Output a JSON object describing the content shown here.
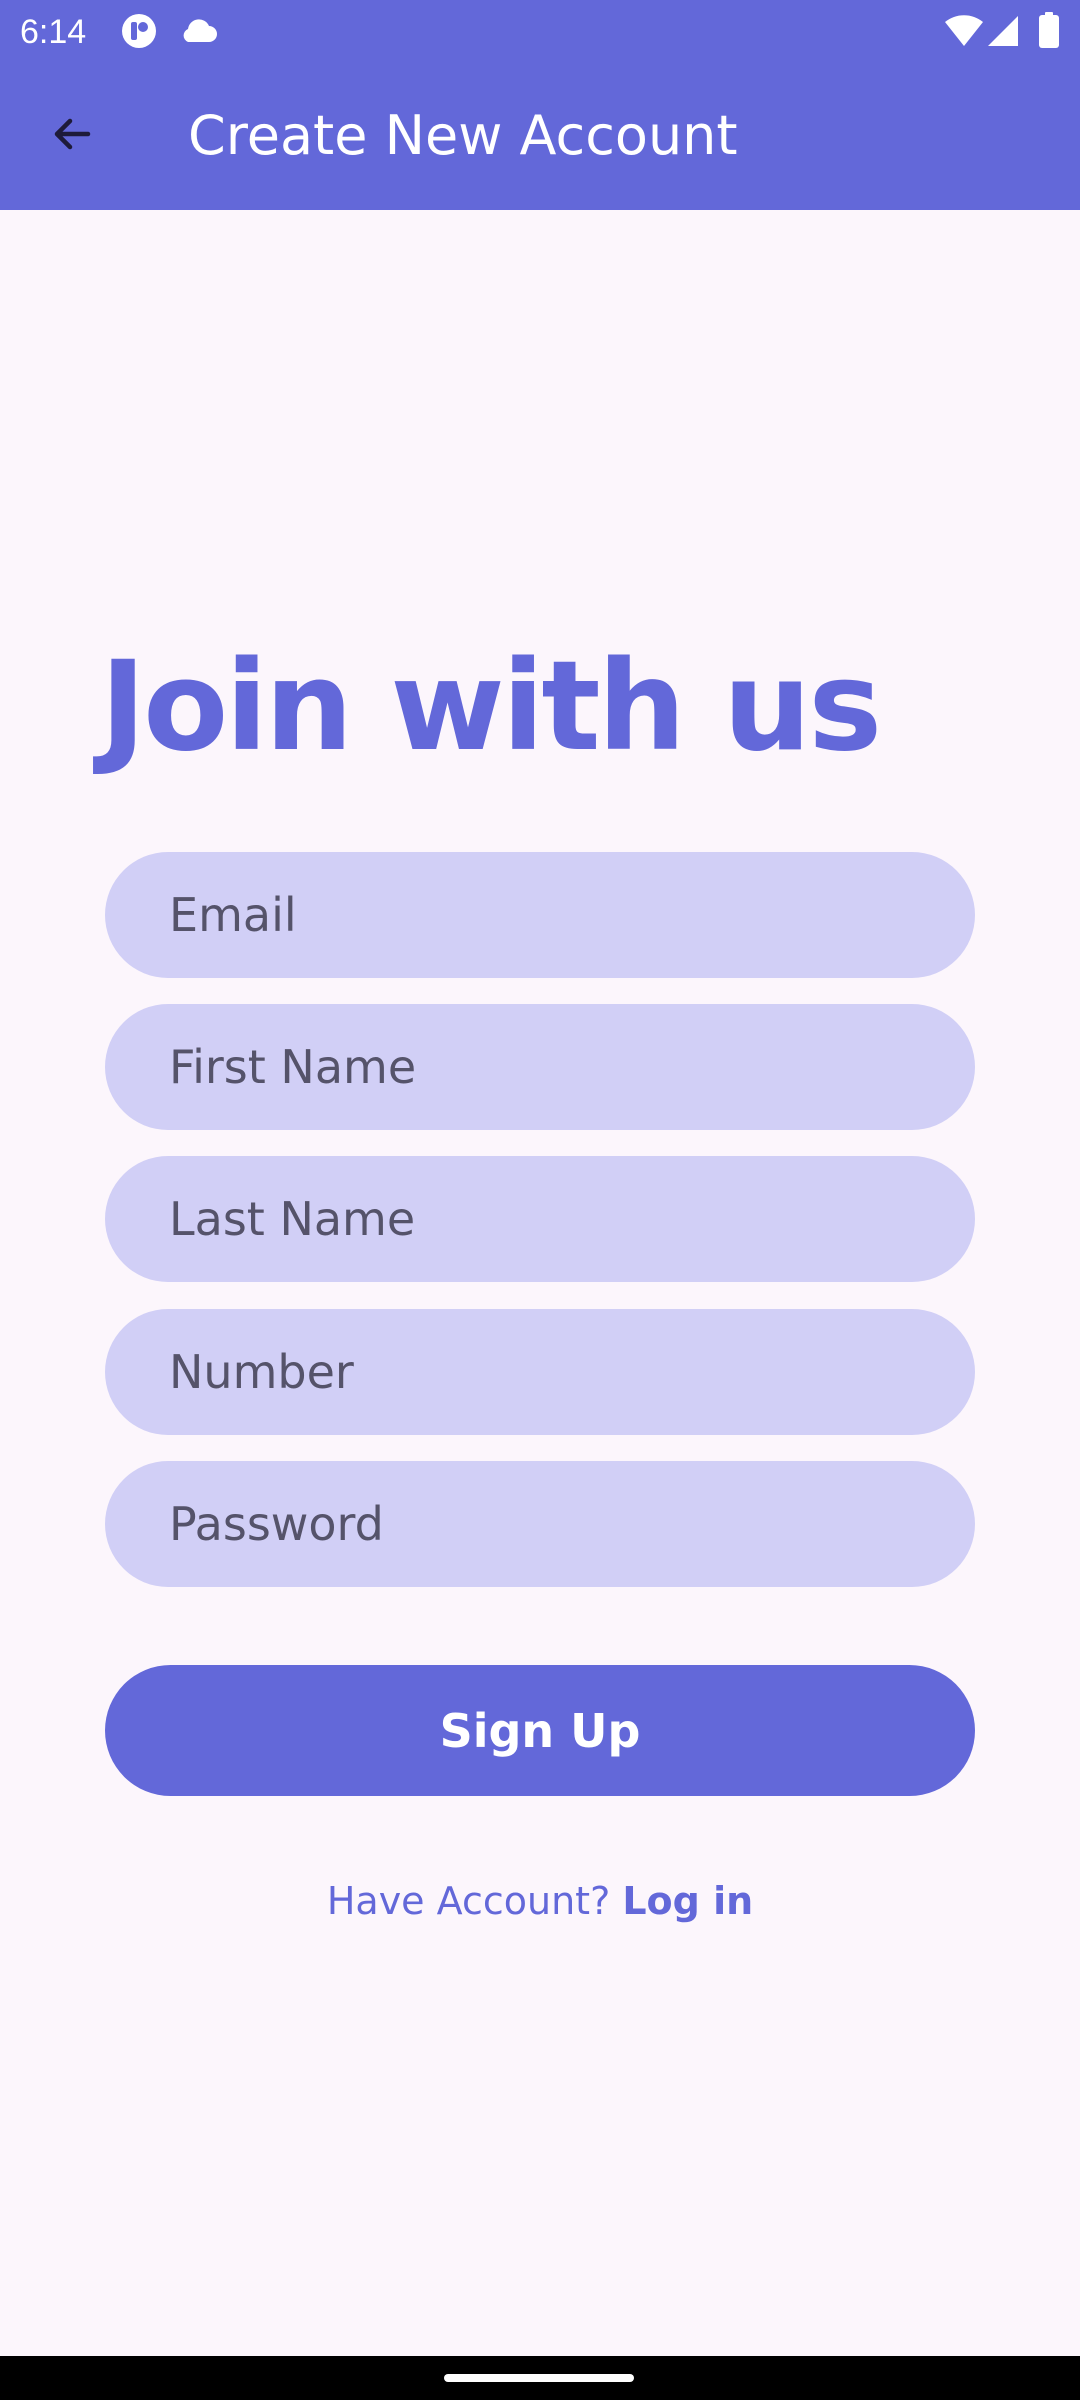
{
  "status_bar": {
    "time": "6:14",
    "icons": [
      "notification-app-icon",
      "cloud-icon",
      "wifi-icon",
      "cell-signal-icon",
      "battery-icon"
    ]
  },
  "app_bar": {
    "back_icon": "arrow-back-icon",
    "title": "Create New Account"
  },
  "main": {
    "heading": "Join with us",
    "fields": {
      "email": {
        "placeholder": "Email",
        "value": ""
      },
      "first_name": {
        "placeholder": "First Name",
        "value": ""
      },
      "last_name": {
        "placeholder": "Last Name",
        "value": ""
      },
      "number": {
        "placeholder": "Number",
        "value": ""
      },
      "password": {
        "placeholder": "Password",
        "value": ""
      }
    },
    "signup_label": "Sign Up",
    "login_prompt": "Have Account? ",
    "login_link": "Log in"
  },
  "colors": {
    "primary": "#6368D9",
    "field_background": "#D1CFF6",
    "page_background": "#FCF6FC",
    "on_primary": "#FFFFFF"
  }
}
